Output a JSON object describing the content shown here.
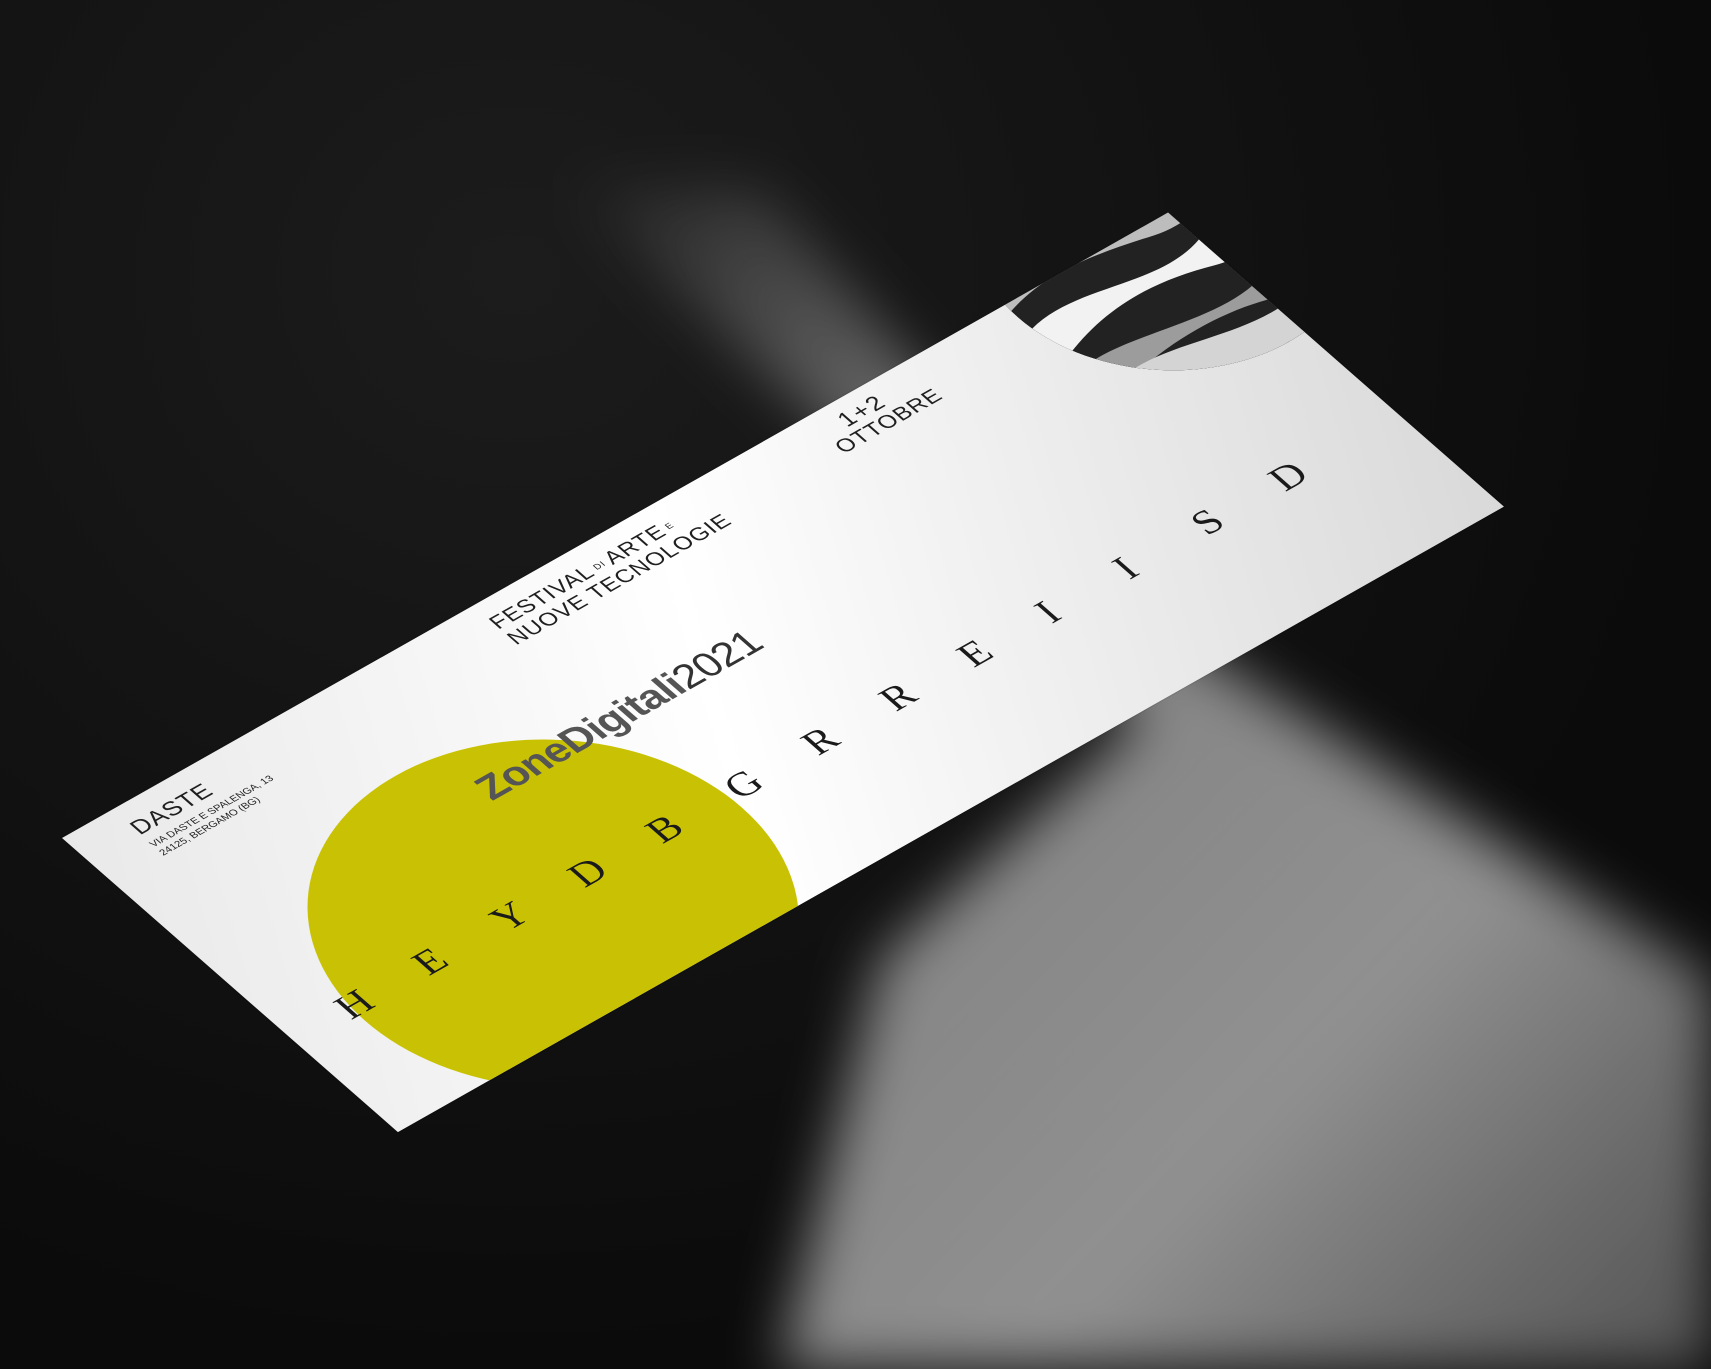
{
  "ticket": {
    "venue_name": "DASTE",
    "venue_address_line1": "VIA DASTE E SPALENGA, 13",
    "venue_address_line2": "24125, BERGAMO (BG)",
    "festival_line1_a": "FESTIVAL",
    "festival_line1_small": "DI",
    "festival_line1_b": "ARTE",
    "festival_line1_small2": "E",
    "festival_line2": "NUOVE TECNOLOGIE",
    "date_days": "1+2",
    "date_month": "OTTOBRE",
    "brand_bold": "ZoneDigitali",
    "brand_year": "2021",
    "headline_letters": [
      "H",
      "E",
      "Y",
      "D",
      "B",
      "G",
      "R",
      "R",
      "E",
      "I",
      "I",
      "S",
      "D"
    ],
    "accent_color": "#c9c204"
  }
}
